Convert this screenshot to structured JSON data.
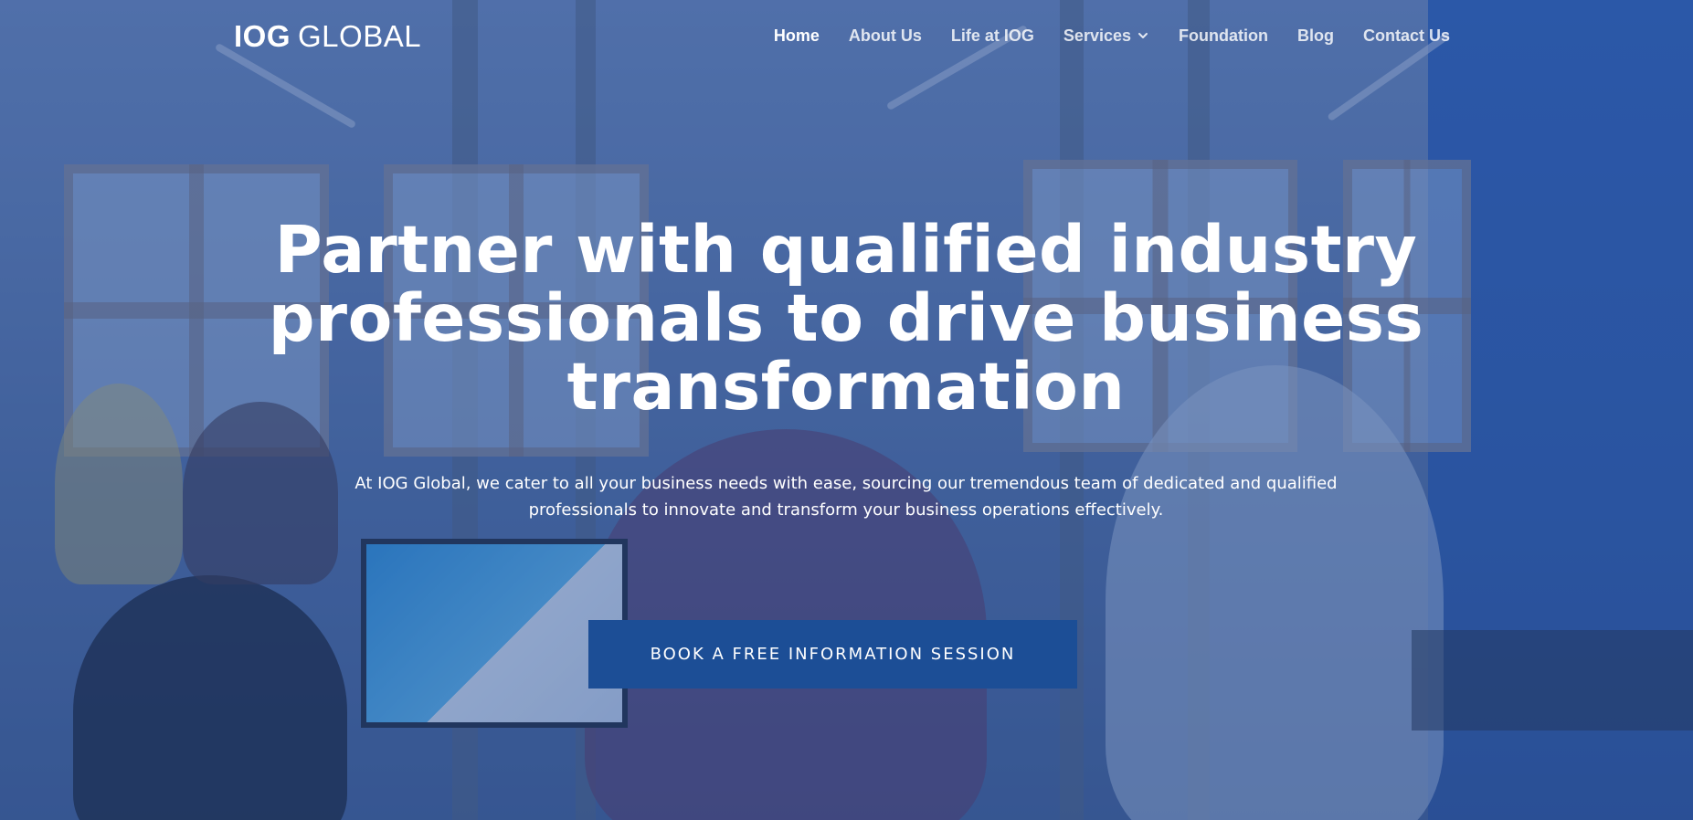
{
  "brand": {
    "logo_bold": "IOG",
    "logo_light": "GLOBAL"
  },
  "nav": {
    "items": [
      {
        "label": "Home",
        "active": true
      },
      {
        "label": "About Us"
      },
      {
        "label": "Life at IOG"
      },
      {
        "label": "Services",
        "has_dropdown": true,
        "icon": "chevron-down-icon"
      },
      {
        "label": "Foundation"
      },
      {
        "label": "Blog"
      },
      {
        "label": "Contact Us"
      }
    ]
  },
  "hero": {
    "headline": "Partner with qualified industry professionals to drive business transformation",
    "subtext": "At IOG Global, we cater to all your business needs with ease, sourcing our tremendous team of dedicated and qualified professionals to innovate and transform your business operations effectively.",
    "cta_label": "BOOK A FREE INFORMATION SESSION"
  },
  "colors": {
    "overlay": "#2c5096",
    "cta_background": "#1c4e96",
    "text": "#ffffff"
  }
}
